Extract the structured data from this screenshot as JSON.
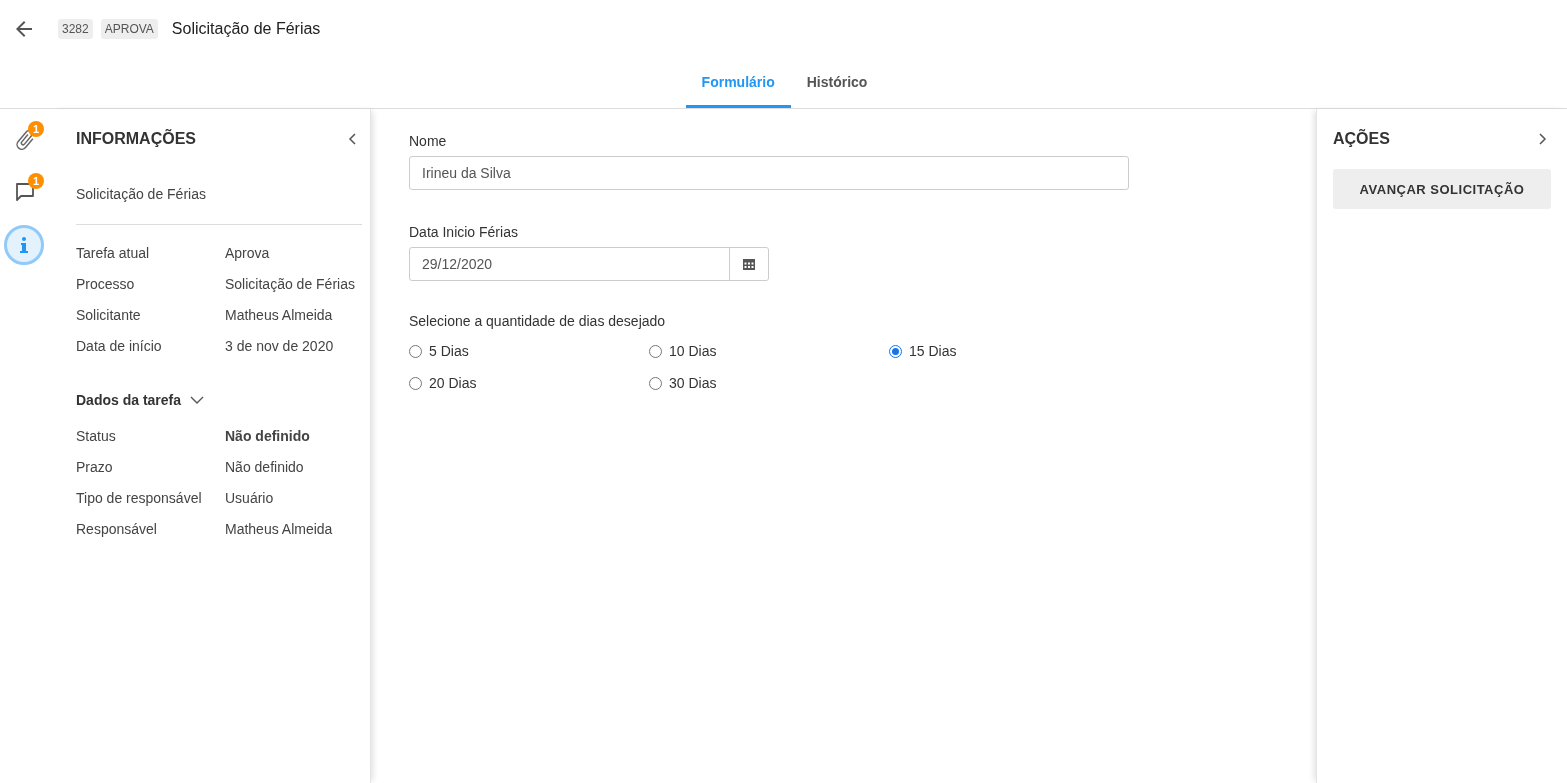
{
  "header": {
    "id_tag": "3282",
    "task_tag": "APROVA",
    "title": "Solicitação de Férias"
  },
  "tabs": [
    {
      "label": "Formulário",
      "selected": true
    },
    {
      "label": "Histórico",
      "selected": false
    }
  ],
  "rail": [
    {
      "kind": "attachment",
      "badge": "1",
      "selected": false
    },
    {
      "kind": "comment",
      "badge": "1",
      "selected": false
    },
    {
      "kind": "info",
      "selected": true
    }
  ],
  "info_panel": {
    "title": "INFORMAÇÕES",
    "subtitle": "Solicitação de Férias",
    "rows": [
      {
        "label": "Tarefa atual",
        "value": "Aprova"
      },
      {
        "label": "Processo",
        "value": "Solicitação de Férias"
      },
      {
        "label": "Solicitante",
        "value": "Matheus Almeida"
      },
      {
        "label": "Data de início",
        "value": "3 de nov de 2020"
      }
    ],
    "task_section": {
      "title": "Dados da tarefa",
      "expanded": true,
      "rows": [
        {
          "label": "Status",
          "value": "Não definido",
          "bold": true
        },
        {
          "label": "Prazo",
          "value": "Não definido",
          "bold": false
        },
        {
          "label": "Tipo de responsável",
          "value": "Usuário",
          "bold": false
        },
        {
          "label": "Responsável",
          "value": "Matheus Almeida",
          "bold": false
        }
      ]
    }
  },
  "form": {
    "name_field": {
      "label": "Nome",
      "value": "Irineu da Silva"
    },
    "date_field": {
      "label": "Data Inicio Férias",
      "value": "29/12/2020"
    },
    "days": {
      "label": "Selecione a quantidade de dias desejado",
      "options": [
        {
          "label": "5 Dias",
          "selected": false
        },
        {
          "label": "10 Dias",
          "selected": false
        },
        {
          "label": "15 Dias",
          "selected": true
        },
        {
          "label": "20 Dias",
          "selected": false
        },
        {
          "label": "30 Dias",
          "selected": false
        }
      ]
    }
  },
  "actions_panel": {
    "title": "AÇÕES",
    "buttons": [
      "AVANÇAR SOLICITAÇÃO"
    ]
  }
}
